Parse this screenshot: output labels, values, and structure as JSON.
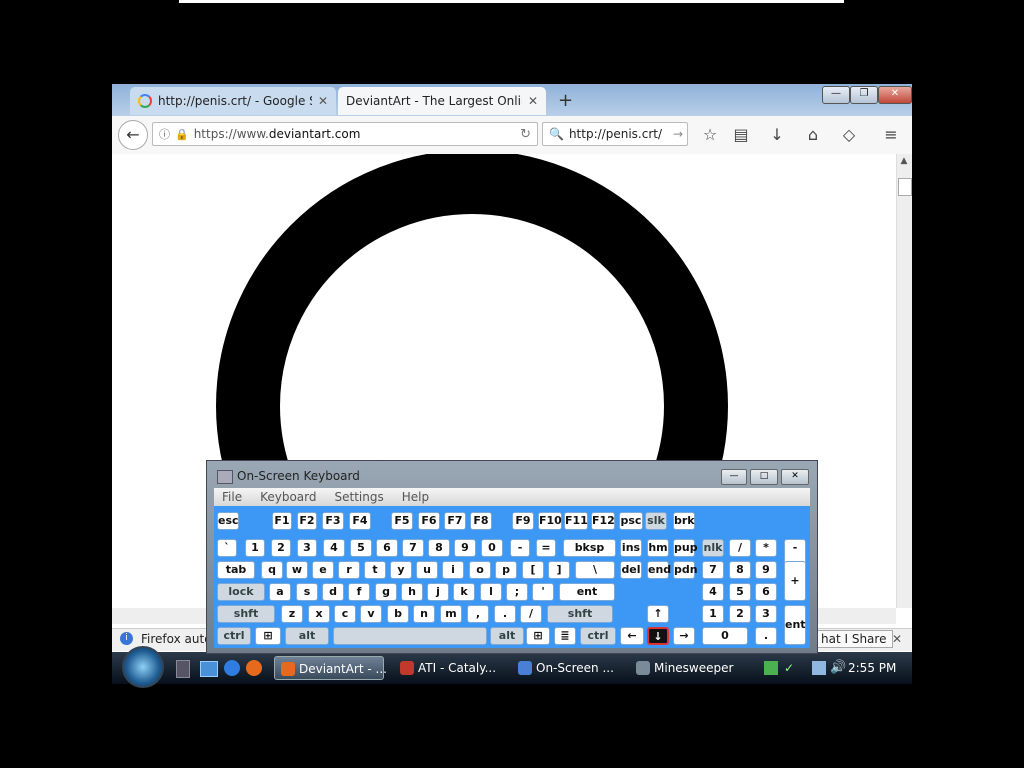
{
  "browser": {
    "tabs": [
      {
        "title": "http://penis.crt/ - Google S...",
        "close": "✕"
      },
      {
        "title": "DeviantArt - The Largest Onlin...",
        "close": "✕"
      }
    ],
    "new_tab": "+",
    "controls": {
      "minimize": "—",
      "maximize": "❐",
      "close": "✕"
    },
    "back": "←",
    "url": {
      "info": "ⓘ",
      "lock": "🔒",
      "prefix": "https://www.",
      "host": "deviantart.com",
      "reload": "↻"
    },
    "search": {
      "value": "http://penis.crt/",
      "go": "→"
    },
    "toolbar_icons": [
      "☆",
      "▤",
      "↓",
      "⌂",
      "◇",
      "≡"
    ],
    "notification": {
      "text": "Firefox autor",
      "right_text": "hat I Share",
      "close": "✕"
    }
  },
  "taskbar": {
    "items": [
      {
        "label": "DeviantArt - ...",
        "icon_color": "#e66a1e"
      },
      {
        "label": "ATI - Cataly...",
        "icon_color": "#c0392b"
      },
      {
        "label": "On-Screen ...",
        "icon_color": "#4a7fd6"
      },
      {
        "label": "Minesweeper",
        "icon_color": "#7a8a99"
      }
    ],
    "clock": "2:55 PM"
  },
  "osk": {
    "title": "On-Screen Keyboard",
    "menu": [
      "File",
      "Keyboard",
      "Settings",
      "Help"
    ],
    "buttons": {
      "min": "—",
      "max": "□",
      "close": "✕"
    },
    "keys": {
      "r1": [
        "esc",
        "F1",
        "F2",
        "F3",
        "F4",
        "F5",
        "F6",
        "F7",
        "F8",
        "F9",
        "F10",
        "F11",
        "F12",
        "psc",
        "slk",
        "brk"
      ],
      "r2": [
        "`",
        "1",
        "2",
        "3",
        "4",
        "5",
        "6",
        "7",
        "8",
        "9",
        "0",
        "-",
        "=",
        "bksp",
        "ins",
        "hm",
        "pup",
        "nlk",
        "/",
        "*",
        "-"
      ],
      "r3": [
        "tab",
        "q",
        "w",
        "e",
        "r",
        "t",
        "y",
        "u",
        "i",
        "o",
        "p",
        "[",
        "]",
        "\\",
        "del",
        "end",
        "pdn",
        "7",
        "8",
        "9",
        "+"
      ],
      "r4": [
        "lock",
        "a",
        "s",
        "d",
        "f",
        "g",
        "h",
        "j",
        "k",
        "l",
        ";",
        "'",
        "ent",
        "4",
        "5",
        "6"
      ],
      "r5": [
        "shft",
        "z",
        "x",
        "c",
        "v",
        "b",
        "n",
        "m",
        ",",
        ".",
        "/",
        "shft",
        "↑",
        "1",
        "2",
        "3",
        "ent"
      ],
      "r6": [
        "ctrl",
        "⊞",
        "alt",
        "",
        "alt",
        "⊞",
        "≣",
        "ctrl",
        "←",
        "↓",
        "→",
        "0",
        "."
      ]
    }
  }
}
